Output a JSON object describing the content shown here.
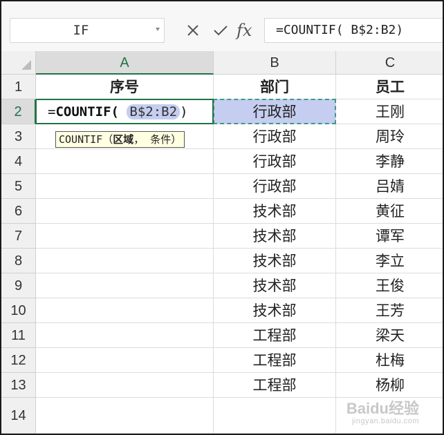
{
  "name_box": {
    "value": "IF"
  },
  "formula_bar": {
    "cancel_icon": "x-icon",
    "confirm_icon": "check-icon",
    "fx_label": "fx",
    "formula": "=COUNTIF( B$2:B2)"
  },
  "columns": [
    "A",
    "B",
    "C"
  ],
  "rows": [
    "1",
    "2",
    "3",
    "4",
    "5",
    "6",
    "7",
    "8",
    "9",
    "10",
    "11",
    "12",
    "13",
    "14"
  ],
  "header_row": {
    "a": "序号",
    "b": "部门",
    "c": "员工"
  },
  "data_rows": [
    {
      "b": "行政部",
      "c": "王刚"
    },
    {
      "b": "行政部",
      "c": "周玲"
    },
    {
      "b": "行政部",
      "c": "李静"
    },
    {
      "b": "行政部",
      "c": "吕婧"
    },
    {
      "b": "技术部",
      "c": "黄征"
    },
    {
      "b": "技术部",
      "c": "谭军"
    },
    {
      "b": "技术部",
      "c": "李立"
    },
    {
      "b": "技术部",
      "c": "王俊"
    },
    {
      "b": "技术部",
      "c": "王芳"
    },
    {
      "b": "工程部",
      "c": "梁天"
    },
    {
      "b": "工程部",
      "c": "杜梅"
    },
    {
      "b": "工程部",
      "c": "杨柳"
    }
  ],
  "editing_cell": {
    "address": "A2",
    "prefix": "=",
    "function": "COUNTIF",
    "open": "( ",
    "range_ref": "B$2:B2",
    "close": ")"
  },
  "tooltip": {
    "function": "COUNTIF",
    "open": "（",
    "arg1": "区域",
    "sep": "，",
    "arg2": " 条件",
    "close": "）"
  },
  "watermark": {
    "brand": "Baidu经验",
    "url": "jingyan.baidu.com"
  },
  "colors": {
    "accent": "#217346",
    "range_highlight": "#c5cdf0",
    "marquee": "#3c9a8a",
    "tooltip_bg": "#ffffe1"
  }
}
